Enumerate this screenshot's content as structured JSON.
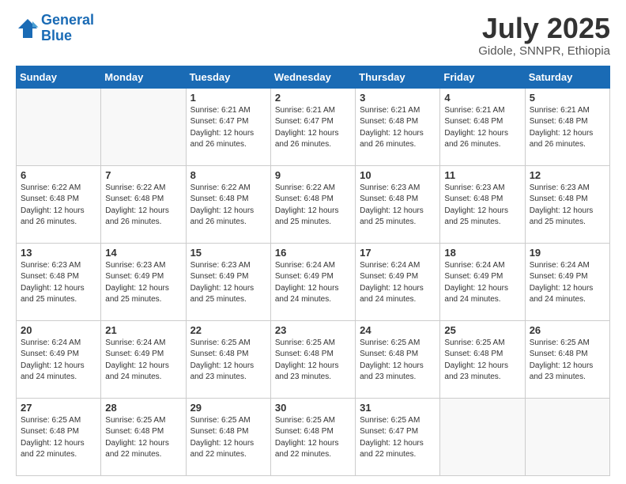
{
  "header": {
    "logo_line1": "General",
    "logo_line2": "Blue",
    "month_title": "July 2025",
    "location": "Gidole, SNNPR, Ethiopia"
  },
  "weekdays": [
    "Sunday",
    "Monday",
    "Tuesday",
    "Wednesday",
    "Thursday",
    "Friday",
    "Saturday"
  ],
  "weeks": [
    [
      {
        "day": null
      },
      {
        "day": null
      },
      {
        "day": "1",
        "sunrise": "Sunrise: 6:21 AM",
        "sunset": "Sunset: 6:47 PM",
        "daylight": "Daylight: 12 hours and 26 minutes."
      },
      {
        "day": "2",
        "sunrise": "Sunrise: 6:21 AM",
        "sunset": "Sunset: 6:47 PM",
        "daylight": "Daylight: 12 hours and 26 minutes."
      },
      {
        "day": "3",
        "sunrise": "Sunrise: 6:21 AM",
        "sunset": "Sunset: 6:48 PM",
        "daylight": "Daylight: 12 hours and 26 minutes."
      },
      {
        "day": "4",
        "sunrise": "Sunrise: 6:21 AM",
        "sunset": "Sunset: 6:48 PM",
        "daylight": "Daylight: 12 hours and 26 minutes."
      },
      {
        "day": "5",
        "sunrise": "Sunrise: 6:21 AM",
        "sunset": "Sunset: 6:48 PM",
        "daylight": "Daylight: 12 hours and 26 minutes."
      }
    ],
    [
      {
        "day": "6",
        "sunrise": "Sunrise: 6:22 AM",
        "sunset": "Sunset: 6:48 PM",
        "daylight": "Daylight: 12 hours and 26 minutes."
      },
      {
        "day": "7",
        "sunrise": "Sunrise: 6:22 AM",
        "sunset": "Sunset: 6:48 PM",
        "daylight": "Daylight: 12 hours and 26 minutes."
      },
      {
        "day": "8",
        "sunrise": "Sunrise: 6:22 AM",
        "sunset": "Sunset: 6:48 PM",
        "daylight": "Daylight: 12 hours and 26 minutes."
      },
      {
        "day": "9",
        "sunrise": "Sunrise: 6:22 AM",
        "sunset": "Sunset: 6:48 PM",
        "daylight": "Daylight: 12 hours and 25 minutes."
      },
      {
        "day": "10",
        "sunrise": "Sunrise: 6:23 AM",
        "sunset": "Sunset: 6:48 PM",
        "daylight": "Daylight: 12 hours and 25 minutes."
      },
      {
        "day": "11",
        "sunrise": "Sunrise: 6:23 AM",
        "sunset": "Sunset: 6:48 PM",
        "daylight": "Daylight: 12 hours and 25 minutes."
      },
      {
        "day": "12",
        "sunrise": "Sunrise: 6:23 AM",
        "sunset": "Sunset: 6:48 PM",
        "daylight": "Daylight: 12 hours and 25 minutes."
      }
    ],
    [
      {
        "day": "13",
        "sunrise": "Sunrise: 6:23 AM",
        "sunset": "Sunset: 6:48 PM",
        "daylight": "Daylight: 12 hours and 25 minutes."
      },
      {
        "day": "14",
        "sunrise": "Sunrise: 6:23 AM",
        "sunset": "Sunset: 6:49 PM",
        "daylight": "Daylight: 12 hours and 25 minutes."
      },
      {
        "day": "15",
        "sunrise": "Sunrise: 6:23 AM",
        "sunset": "Sunset: 6:49 PM",
        "daylight": "Daylight: 12 hours and 25 minutes."
      },
      {
        "day": "16",
        "sunrise": "Sunrise: 6:24 AM",
        "sunset": "Sunset: 6:49 PM",
        "daylight": "Daylight: 12 hours and 24 minutes."
      },
      {
        "day": "17",
        "sunrise": "Sunrise: 6:24 AM",
        "sunset": "Sunset: 6:49 PM",
        "daylight": "Daylight: 12 hours and 24 minutes."
      },
      {
        "day": "18",
        "sunrise": "Sunrise: 6:24 AM",
        "sunset": "Sunset: 6:49 PM",
        "daylight": "Daylight: 12 hours and 24 minutes."
      },
      {
        "day": "19",
        "sunrise": "Sunrise: 6:24 AM",
        "sunset": "Sunset: 6:49 PM",
        "daylight": "Daylight: 12 hours and 24 minutes."
      }
    ],
    [
      {
        "day": "20",
        "sunrise": "Sunrise: 6:24 AM",
        "sunset": "Sunset: 6:49 PM",
        "daylight": "Daylight: 12 hours and 24 minutes."
      },
      {
        "day": "21",
        "sunrise": "Sunrise: 6:24 AM",
        "sunset": "Sunset: 6:49 PM",
        "daylight": "Daylight: 12 hours and 24 minutes."
      },
      {
        "day": "22",
        "sunrise": "Sunrise: 6:25 AM",
        "sunset": "Sunset: 6:48 PM",
        "daylight": "Daylight: 12 hours and 23 minutes."
      },
      {
        "day": "23",
        "sunrise": "Sunrise: 6:25 AM",
        "sunset": "Sunset: 6:48 PM",
        "daylight": "Daylight: 12 hours and 23 minutes."
      },
      {
        "day": "24",
        "sunrise": "Sunrise: 6:25 AM",
        "sunset": "Sunset: 6:48 PM",
        "daylight": "Daylight: 12 hours and 23 minutes."
      },
      {
        "day": "25",
        "sunrise": "Sunrise: 6:25 AM",
        "sunset": "Sunset: 6:48 PM",
        "daylight": "Daylight: 12 hours and 23 minutes."
      },
      {
        "day": "26",
        "sunrise": "Sunrise: 6:25 AM",
        "sunset": "Sunset: 6:48 PM",
        "daylight": "Daylight: 12 hours and 23 minutes."
      }
    ],
    [
      {
        "day": "27",
        "sunrise": "Sunrise: 6:25 AM",
        "sunset": "Sunset: 6:48 PM",
        "daylight": "Daylight: 12 hours and 22 minutes."
      },
      {
        "day": "28",
        "sunrise": "Sunrise: 6:25 AM",
        "sunset": "Sunset: 6:48 PM",
        "daylight": "Daylight: 12 hours and 22 minutes."
      },
      {
        "day": "29",
        "sunrise": "Sunrise: 6:25 AM",
        "sunset": "Sunset: 6:48 PM",
        "daylight": "Daylight: 12 hours and 22 minutes."
      },
      {
        "day": "30",
        "sunrise": "Sunrise: 6:25 AM",
        "sunset": "Sunset: 6:48 PM",
        "daylight": "Daylight: 12 hours and 22 minutes."
      },
      {
        "day": "31",
        "sunrise": "Sunrise: 6:25 AM",
        "sunset": "Sunset: 6:47 PM",
        "daylight": "Daylight: 12 hours and 22 minutes."
      },
      {
        "day": null
      },
      {
        "day": null
      }
    ]
  ]
}
